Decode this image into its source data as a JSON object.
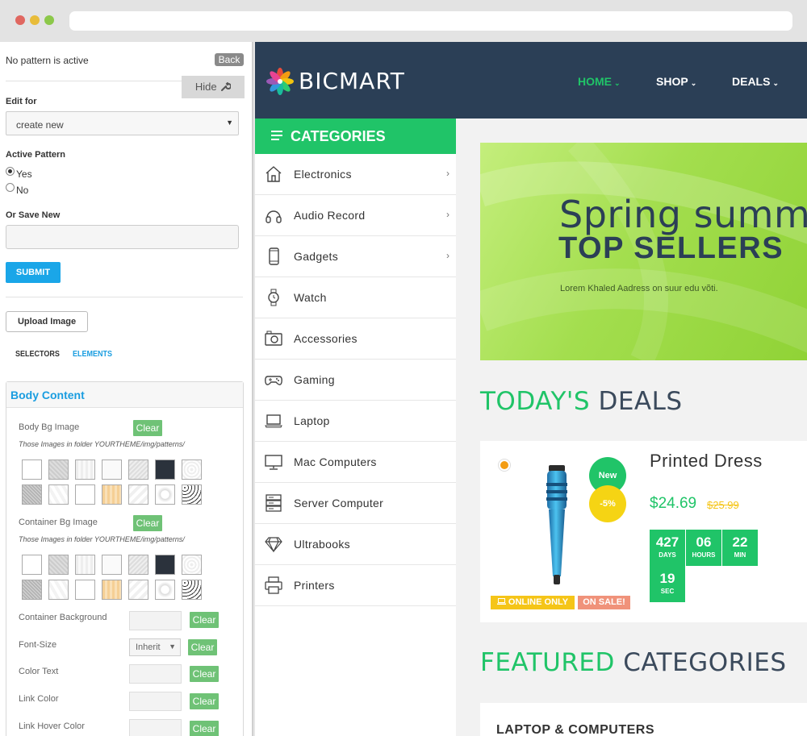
{
  "panel": {
    "status": "No pattern is active",
    "back_label": "Back",
    "hide_label": "Hide",
    "edit_for_label": "Edit for",
    "edit_for_value": "create new",
    "active_pattern_label": "Active Pattern",
    "yes_label": "Yes",
    "no_label": "No",
    "active_pattern_value": "Yes",
    "save_new_label": "Or Save New",
    "save_new_value": "",
    "submit_label": "SUBMIT",
    "upload_label": "Upload Image",
    "tabs": [
      "SELECTORS",
      "ELEMENTS"
    ],
    "active_tab": "ELEMENTS",
    "box_title": "Body Content",
    "body_bg_label": "Body Bg Image",
    "container_bg_label": "Container Bg Image",
    "folder_note": "Those Images in folder YOURTHEME/img/patterns/",
    "clear_label": "Clear",
    "container_background_label": "Container Background",
    "font_size_label": "Font-Size",
    "font_size_value": "Inherit",
    "color_text_label": "Color Text",
    "link_color_label": "Link Color",
    "link_hover_label": "Link Hover Color"
  },
  "site": {
    "brand": "BICMART",
    "nav": [
      {
        "label": "HOME",
        "color": "#20c468"
      },
      {
        "label": "SHOP",
        "color": "#ffffff"
      },
      {
        "label": "DEALS",
        "color": "#ffffff"
      }
    ],
    "categories_title": "CATEGORIES",
    "categories": [
      {
        "label": "Electronics",
        "icon": "house-icon",
        "has_arrow": true
      },
      {
        "label": "Audio Record",
        "icon": "headphones-icon",
        "has_arrow": true
      },
      {
        "label": "Gadgets",
        "icon": "phone-icon",
        "has_arrow": true
      },
      {
        "label": "Watch",
        "icon": "watch-icon",
        "has_arrow": false
      },
      {
        "label": "Accessories",
        "icon": "camera-icon",
        "has_arrow": false
      },
      {
        "label": "Gaming",
        "icon": "gamepad-icon",
        "has_arrow": false
      },
      {
        "label": "Laptop",
        "icon": "laptop-icon",
        "has_arrow": false
      },
      {
        "label": "Mac Computers",
        "icon": "monitor-icon",
        "has_arrow": false
      },
      {
        "label": "Server Computer",
        "icon": "server-icon",
        "has_arrow": false
      },
      {
        "label": "Ultrabooks",
        "icon": "diamond-icon",
        "has_arrow": false
      },
      {
        "label": "Printers",
        "icon": "printer-icon",
        "has_arrow": false
      }
    ],
    "banner": {
      "line1": "Spring summ",
      "line2": "TOP SELLERS",
      "line3": "Lorem Khaled Aadress on suur edu võti."
    },
    "deals_title_a": "TODAY'S",
    "deals_title_b": "DEALS",
    "deal": {
      "name": "Printed Dress",
      "price": "$24.69",
      "old_price": "$25.99",
      "badge_new": "New",
      "badge_discount": "-5%",
      "tag_online": "ONLINE ONLY",
      "tag_sale": "ON SALE!",
      "countdown": [
        {
          "value": "427",
          "unit": "DAYS"
        },
        {
          "value": "06",
          "unit": "HOURS"
        },
        {
          "value": "22",
          "unit": "MIN"
        },
        {
          "value": "19",
          "unit": "SEC"
        }
      ]
    },
    "featured_title_a": "FEATURED",
    "featured_title_b": "CATEGORIES",
    "featured_card_title": "LAPTOP & COMPUTERS"
  },
  "colors": {
    "accent_green": "#20c468",
    "header_navy": "#2b3f56",
    "submit_blue": "#1aa6e8",
    "sale_yellow": "#f5c518"
  }
}
